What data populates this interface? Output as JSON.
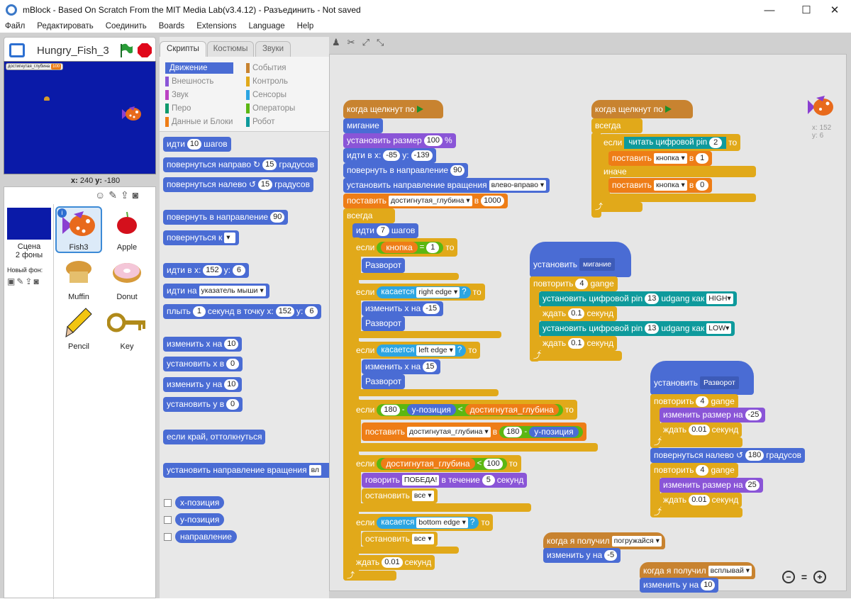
{
  "window": {
    "title": "mBlock - Based On Scratch From the MIT Media Lab(v3.4.12) - Разъединить - Not saved",
    "minimize": "—",
    "maximize": "☐",
    "close": "✕"
  },
  "menu": [
    "Файл",
    "Редактировать",
    "Соединить",
    "Boards",
    "Extensions",
    "Language",
    "Help"
  ],
  "stage": {
    "project_name": "Hungry_Fish_3",
    "variable_label": "достигнутая_глубина",
    "variable_value": "100",
    "x_label": "x:",
    "x_value": "240",
    "y_label": "y:",
    "y_value": "-180"
  },
  "sprites": {
    "stage_label": "Сцена",
    "stage_backdrops": "2 фоны",
    "new_backdrop_label": "Новый фон:",
    "items": [
      "Fish3",
      "Apple",
      "Muffin",
      "Donut",
      "Pencil",
      "Key"
    ]
  },
  "tabs": [
    "Скрипты",
    "Костюмы",
    "Звуки"
  ],
  "categories": {
    "left": [
      "Движение",
      "Внешность",
      "Звук",
      "Перо",
      "Данные и Блоки"
    ],
    "right": [
      "События",
      "Контроль",
      "Сенсоры",
      "Операторы",
      "Робот"
    ],
    "colors_left": [
      "#4a6cd4",
      "#8a55d7",
      "#bb42c3",
      "#0e9a6c",
      "#ee7d16"
    ],
    "colors_right": [
      "#c88330",
      "#e1a91a",
      "#2ca5e2",
      "#5cb712",
      "#0e9a9c"
    ]
  },
  "palette": {
    "move": "идти",
    "move_n": "10",
    "move_steps": "шагов",
    "turn_right": "повернуться направо",
    "turn_right_n": "15",
    "turn_right_unit": "градусов",
    "turn_left": "повернуться налево",
    "turn_left_n": "15",
    "turn_left_unit": "градусов",
    "point_dir": "повернуть в направление",
    "point_dir_n": "90",
    "point_to": "повернуться к",
    "goto_xy": "идти в x:",
    "goto_x": "152",
    "goto_y_label": "y:",
    "goto_y": "6",
    "goto": "идти на",
    "goto_target": "указатель мыши",
    "glide": "плыть",
    "glide_n": "1",
    "glide_mid": "секунд в точку x:",
    "glide_x": "152",
    "glide_y_label": "y:",
    "glide_y": "6",
    "change_x": "изменить х на",
    "change_x_n": "10",
    "set_x": "установить х в",
    "set_x_n": "0",
    "change_y": "изменить у на",
    "change_y_n": "10",
    "set_y": "установить у в",
    "set_y_n": "0",
    "bounce": "если край, оттолкнуться",
    "rot_style": "установить направление вращения",
    "rot_style_tail": "вл",
    "rep_x": "x-позиция",
    "rep_y": "y-позиция",
    "rep_dir": "направление"
  },
  "script1": {
    "hat": "когда щелкнут по",
    "blink": "мигание",
    "size_label": "установить размер",
    "size_n": "100",
    "size_unit": "%",
    "goto_label": "идти в x:",
    "goto_x": "-85",
    "goto_y_label": "y:",
    "goto_y": "-139",
    "dir_label": "повернуть в направление",
    "dir_n": "90",
    "rot_label": "установить направление вращения",
    "rot_val": "влево-вправо",
    "set_label": "поставить",
    "set_var": "достигнутая_глубина",
    "set_in": "в",
    "set_n": "1000",
    "forever": "всегда",
    "move_label": "идти",
    "move_n": "7",
    "move_unit": "шагов",
    "if": "если",
    "then": "то",
    "key_label": "кнопка",
    "eq": "=",
    "key_n": "1",
    "flip": "Разворот",
    "touching": "касается",
    "right_edge": "right edge",
    "q": "?",
    "chx": "изменить х на",
    "chx_a": "-15",
    "chx_b": "15",
    "left_edge": "left edge",
    "n180": "180",
    "minus": "-",
    "ypos": "у-позиция",
    "lt": "<",
    "depth_var": "достигнутая_глубина",
    "set2_label": "поставить",
    "set2_var": "достигнутая_глубина",
    "set2_in": "в",
    "depth_lt_n": "100",
    "say_label": "говорить",
    "say_text": "ПОБЕДА!",
    "say_mid": "в течение",
    "say_n": "5",
    "say_unit": "секунд",
    "stop_label": "остановить",
    "stop_val": "все",
    "bottom_edge": "bottom edge",
    "wait_label": "ждать",
    "wait_n": "0.01",
    "wait_unit": "секунд"
  },
  "script2": {
    "hat": "когда щелкнут по",
    "forever": "всегда",
    "if": "если",
    "read_pin": "читать цифровой pin",
    "pin_n": "2",
    "then": "то",
    "set_label": "поставить",
    "set_var": "кнопка",
    "set_in": "в",
    "set_a": "1",
    "else": "иначе",
    "set_b": "0"
  },
  "script3": {
    "define": "установить",
    "name": "мигание",
    "repeat": "повторить",
    "repeat_n": "4",
    "repeat_unit": "gange",
    "pin_label": "установить цифровой pin",
    "pin_n": "13",
    "pin_mid": "udgang как",
    "high": "HIGH",
    "low": "LOW",
    "wait_label": "ждать",
    "wait_n": "0.1",
    "wait_unit": "секунд"
  },
  "script4": {
    "define": "установить",
    "name": "Разворот",
    "repeat": "повторить",
    "repeat_n": "4",
    "repeat_unit": "gange",
    "size_label": "изменить размер на",
    "size_a": "-25",
    "size_b": "25",
    "wait_label": "ждать",
    "wait_n": "0.01",
    "wait_unit": "секунд",
    "turn_label": "повернуться налево",
    "turn_n": "180",
    "turn_unit": "градусов"
  },
  "script5": {
    "hat": "когда я получил",
    "msg": "погружайся",
    "chy_label": "изменить у на",
    "chy_n": "-5"
  },
  "script6": {
    "hat": "когда я получил",
    "msg": "всплывай",
    "chy_label": "изменить у на",
    "chy_n": "10"
  },
  "sprite_info": {
    "x_label": "x:",
    "x": "152",
    "y_label": "y:",
    "y": "6"
  },
  "zoom": {
    "out": "−",
    "reset": "=",
    "in": "+"
  }
}
